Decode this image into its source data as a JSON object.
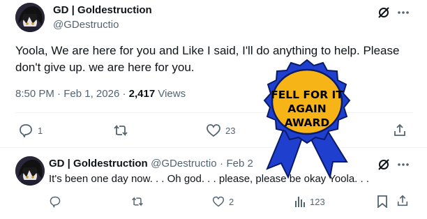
{
  "main_post": {
    "author_name": "GD | Goldestruction",
    "author_handle": "@GDestructio",
    "text": "Yoola, We are here for you and Like I said, I'll do anything to help. Please don't give up. we are here for you.",
    "time": "8:50 PM",
    "date": "Feb 1, 2026",
    "separator": "·",
    "views_count": "2,417",
    "views_label": "Views",
    "replies": "1",
    "likes": "23"
  },
  "reply_post": {
    "author_name": "GD | Goldestruction",
    "author_handle": "@GDestructio",
    "date": "Feb 2",
    "separator": "·",
    "text": "It's been one day now. . . Oh god. . . please, please be okay Yoola. . .",
    "likes": "2",
    "views": "123"
  },
  "award": {
    "line1": "FELL FOR IT",
    "line2": "AGAIN",
    "line3": "AWARD",
    "fill_color": "#f6b417",
    "ribbon_color": "#1f3fcf"
  },
  "icons": [
    "grok-icon",
    "more-icon",
    "reply-icon",
    "retweet-icon",
    "like-icon",
    "views-icon",
    "bookmark-icon",
    "share-icon"
  ]
}
